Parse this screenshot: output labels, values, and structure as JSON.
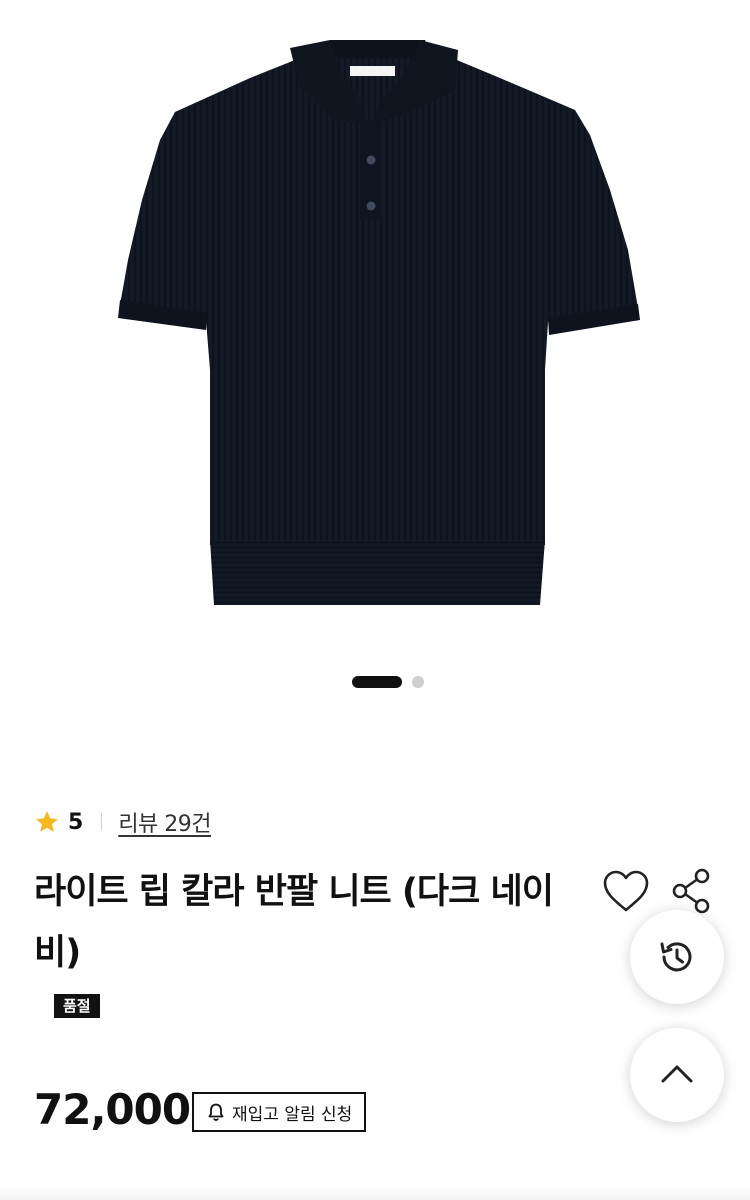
{
  "product": {
    "title": "라이트 립 칼라 반팔 니트 (다크 네이비)",
    "rating": "5",
    "review_link": "리뷰 29건",
    "status_badge": "품절",
    "price": "72,000",
    "restock_label": "재입고 알림 신청"
  },
  "gallery": {
    "total_slides": 2,
    "active_slide": 1
  },
  "icons": {
    "rating": "star-icon",
    "wish": "heart-icon",
    "share": "share-icon",
    "restock": "bell-icon",
    "history": "history-icon",
    "scroll_top": "chevron-up-icon"
  },
  "colors": {
    "star": "#F5B71B",
    "garment": "#141a26",
    "text": "#111111",
    "badge_bg": "#111111",
    "dot_active": "#111111",
    "dot_inactive": "#cfcfcf"
  }
}
